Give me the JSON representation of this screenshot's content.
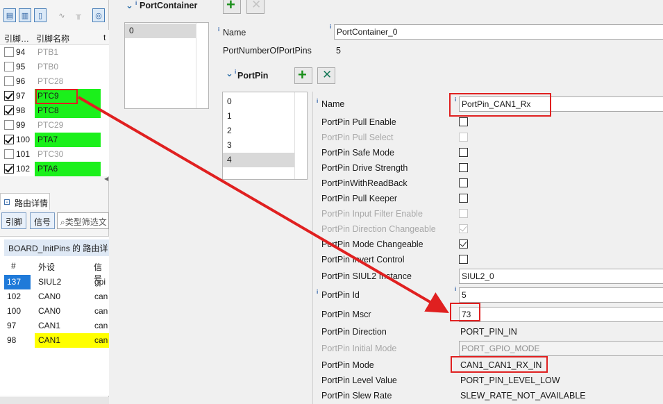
{
  "colors": {
    "accent": "#1bf01b",
    "highlight_yellow": "#ffff00",
    "annotation_red": "#e02020",
    "selected_blue": "#1f7ad9"
  },
  "toolbar": {
    "icons": [
      "layout-icon-1",
      "layout-icon-2",
      "layout-icon-3",
      "wave-icon",
      "signal-icon",
      "target-icon"
    ]
  },
  "pin_table": {
    "headers": [
      "引脚…",
      "引脚名称",
      "t"
    ],
    "rows": [
      {
        "num": "94",
        "name": "PTB1",
        "checked": false,
        "active": false
      },
      {
        "num": "95",
        "name": "PTB0",
        "checked": false,
        "active": false
      },
      {
        "num": "96",
        "name": "PTC28",
        "checked": false,
        "active": false
      },
      {
        "num": "97",
        "name": "PTC9",
        "checked": true,
        "active": true
      },
      {
        "num": "98",
        "name": "PTC8",
        "checked": true,
        "active": true
      },
      {
        "num": "99",
        "name": "PTC29",
        "checked": false,
        "active": false
      },
      {
        "num": "100",
        "name": "PTA7",
        "checked": true,
        "active": true
      },
      {
        "num": "101",
        "name": "PTC30",
        "checked": false,
        "active": false
      },
      {
        "num": "102",
        "name": "PTA6",
        "checked": true,
        "active": true
      }
    ]
  },
  "routing": {
    "tab_label": "路由详情",
    "pin_button": "引脚",
    "signal_button": "信号",
    "search_placeholder": "类型筛选文",
    "title": "BOARD_InitPins 的 路由详",
    "headers": [
      "#",
      "外设",
      "信号"
    ],
    "rows": [
      {
        "num": "137",
        "periph": "SIUL2",
        "signal": "gpi"
      },
      {
        "num": "102",
        "periph": "CAN0",
        "signal": "can"
      },
      {
        "num": "100",
        "periph": "CAN0",
        "signal": "can"
      },
      {
        "num": "97",
        "periph": "CAN1",
        "signal": "can"
      },
      {
        "num": "98",
        "periph": "CAN1",
        "signal": "can"
      }
    ]
  },
  "port_container": {
    "title": "PortContainer",
    "list": [
      "0"
    ],
    "name_label": "Name",
    "name_value": "PortContainer_0",
    "num_pins_label": "PortNumberOfPortPins",
    "num_pins_value": "5"
  },
  "port_pin": {
    "title": "PortPin",
    "list": [
      "0",
      "1",
      "2",
      "3",
      "4"
    ],
    "selected_index": 4,
    "props": [
      {
        "label": "Name",
        "kind": "text",
        "value": "PortPin_CAN1_Rx",
        "info": true
      },
      {
        "label": "PortPin Pull Enable",
        "kind": "check",
        "checked": false,
        "disabled": false
      },
      {
        "label": "PortPin Pull Select",
        "kind": "check",
        "checked": false,
        "disabled": true
      },
      {
        "label": "PortPin Safe Mode",
        "kind": "check",
        "checked": false,
        "disabled": false
      },
      {
        "label": "PortPin Drive Strength",
        "kind": "check",
        "checked": false,
        "disabled": false
      },
      {
        "label": "PortPinWithReadBack",
        "kind": "check",
        "checked": false,
        "disabled": false
      },
      {
        "label": "PortPin Pull Keeper",
        "kind": "check",
        "checked": false,
        "disabled": false
      },
      {
        "label": "PortPin Input Filter Enable",
        "kind": "check",
        "checked": false,
        "disabled": true
      },
      {
        "label": "PortPin Direction Changeable",
        "kind": "check",
        "checked": true,
        "disabled": true
      },
      {
        "label": "PortPin Mode Changeable",
        "kind": "check",
        "checked": true,
        "disabled": false
      },
      {
        "label": "PortPin Invert Control",
        "kind": "check",
        "checked": false,
        "disabled": false
      },
      {
        "label": "PortPin SIUL2 Instance",
        "kind": "select",
        "value": "SIUL2_0"
      },
      {
        "label": "PortPin Id",
        "kind": "text",
        "value": "5",
        "info": true
      },
      {
        "label": "PortPin Mscr",
        "kind": "text",
        "value": "73"
      },
      {
        "label": "PortPin Direction",
        "kind": "static",
        "value": "PORT_PIN_IN"
      },
      {
        "label": "PortPin Initial Mode",
        "kind": "select",
        "value": "PORT_GPIO_MODE",
        "disabled": true
      },
      {
        "label": "PortPin Mode",
        "kind": "static",
        "value": "CAN1_CAN1_RX_IN"
      },
      {
        "label": "PortPin Level Value",
        "kind": "static",
        "value": "PORT_PIN_LEVEL_LOW"
      },
      {
        "label": "PortPin Slew Rate",
        "kind": "static",
        "value": "SLEW_RATE_NOT_AVAILABLE"
      }
    ]
  }
}
